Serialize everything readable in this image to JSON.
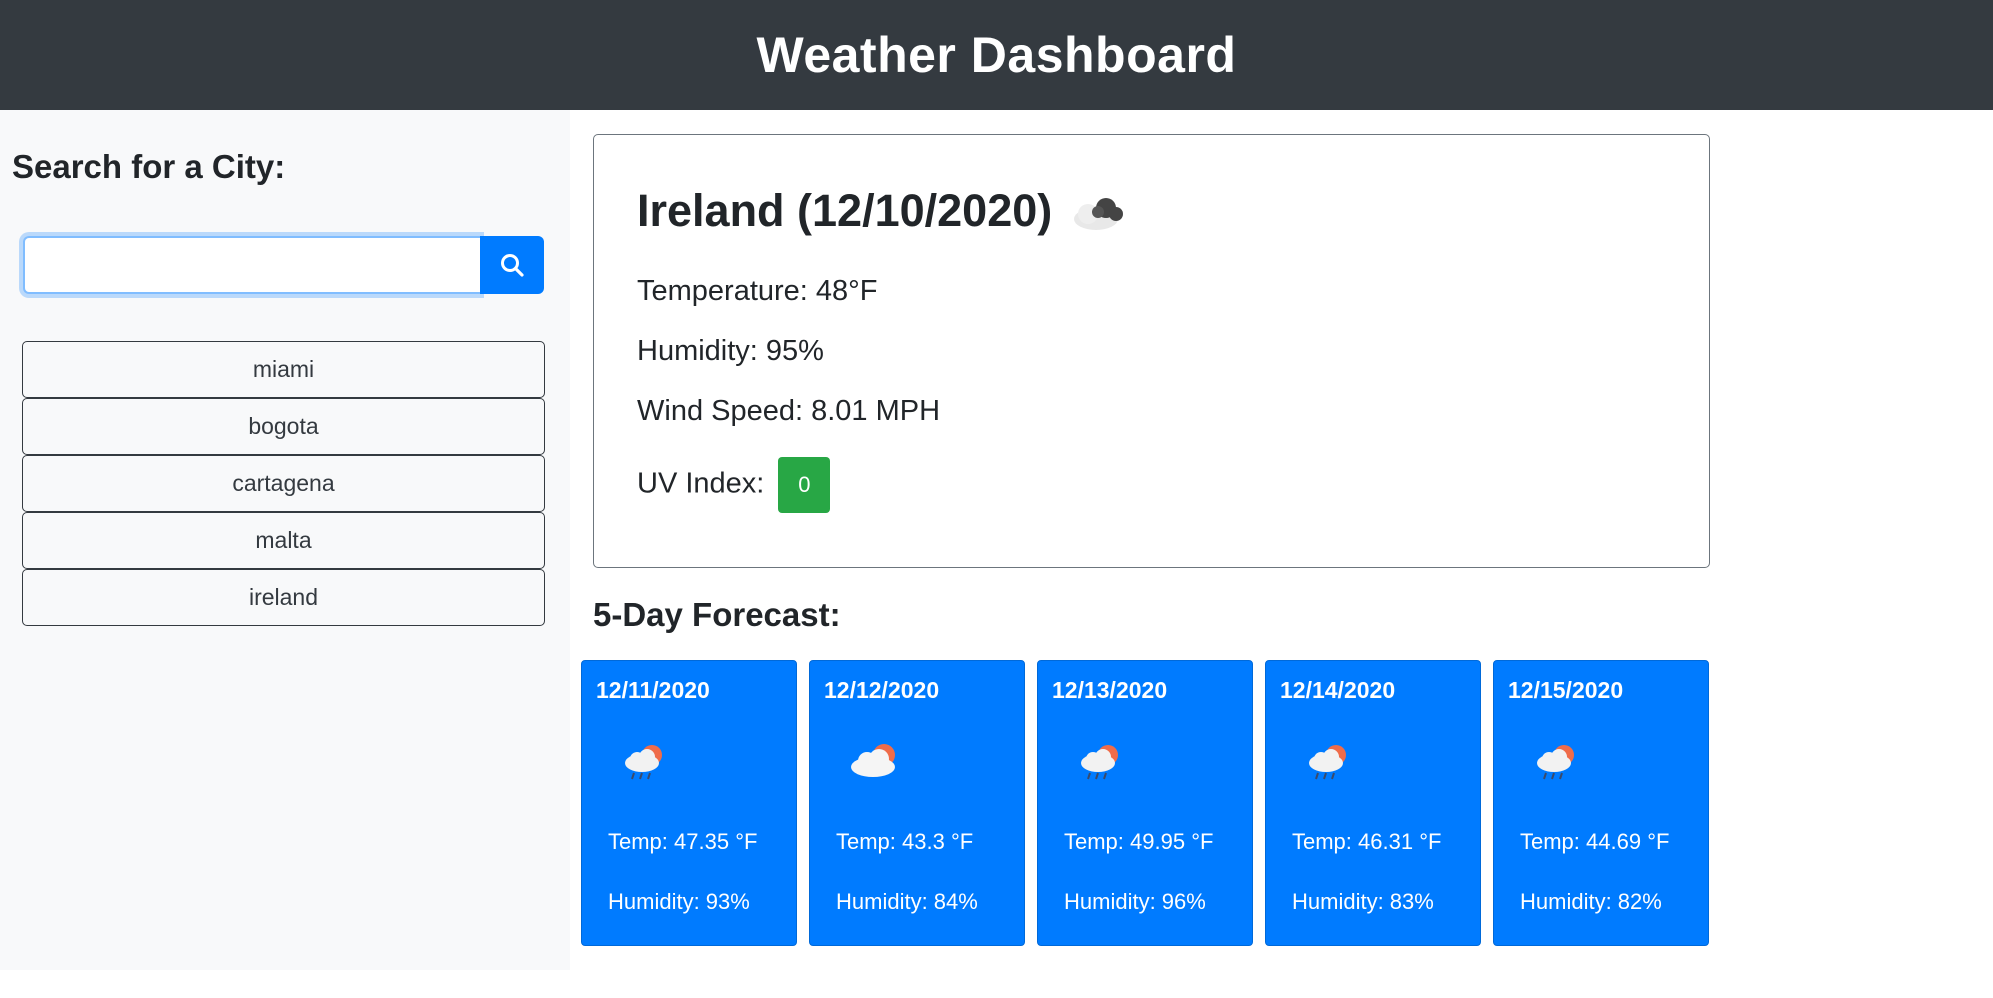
{
  "header": {
    "title": "Weather Dashboard"
  },
  "sidebar": {
    "heading": "Search for a City:",
    "search": {
      "value": "",
      "placeholder": "",
      "button_icon": "search-icon"
    },
    "history": [
      {
        "label": "miami"
      },
      {
        "label": "bogota"
      },
      {
        "label": "cartagena"
      },
      {
        "label": "malta"
      },
      {
        "label": "ireland"
      }
    ]
  },
  "current": {
    "title": "Ireland (12/10/2020)",
    "icon": "cloudy-icon",
    "temperature": "Temperature: 48°F",
    "humidity": "Humidity: 95%",
    "wind": "Wind Speed: 8.01 MPH",
    "uv_label": "UV Index:",
    "uv_value": "0",
    "uv_color": "#28a745"
  },
  "forecast": {
    "title": "5-Day Forecast:",
    "days": [
      {
        "date": "12/11/2020",
        "icon": "rain-sun-icon",
        "temp": "Temp: 47.35 °F",
        "humidity": "Humidity: 93%"
      },
      {
        "date": "12/12/2020",
        "icon": "cloud-sun-icon",
        "temp": "Temp: 43.3 °F",
        "humidity": "Humidity: 84%"
      },
      {
        "date": "12/13/2020",
        "icon": "rain-sun-icon",
        "temp": "Temp: 49.95 °F",
        "humidity": "Humidity: 96%"
      },
      {
        "date": "12/14/2020",
        "icon": "rain-sun-icon",
        "temp": "Temp: 46.31 °F",
        "humidity": "Humidity: 83%"
      },
      {
        "date": "12/15/2020",
        "icon": "rain-sun-icon",
        "temp": "Temp: 44.69 °F",
        "humidity": "Humidity: 82%"
      }
    ]
  },
  "colors": {
    "header_bg": "#343a40",
    "accent": "#007bff",
    "uv_low": "#28a745"
  }
}
